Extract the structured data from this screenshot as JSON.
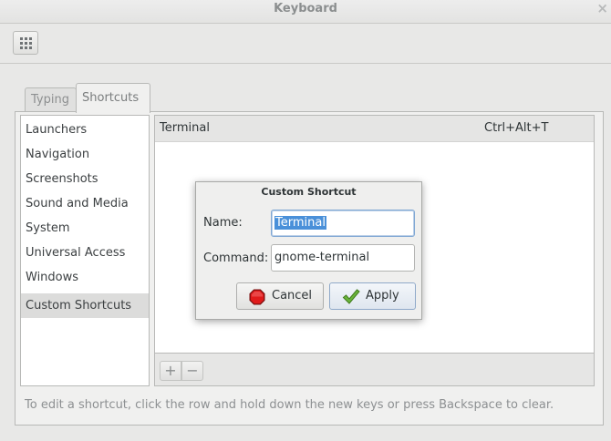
{
  "window": {
    "title": "Keyboard",
    "close_glyph": "×"
  },
  "toolbar": {
    "grid_icon": "grid-icon"
  },
  "tabs": [
    {
      "label": "Typing",
      "active": false
    },
    {
      "label": "Shortcuts",
      "active": true
    }
  ],
  "sidebar": {
    "items": [
      {
        "label": "Launchers"
      },
      {
        "label": "Navigation"
      },
      {
        "label": "Screenshots"
      },
      {
        "label": "Sound and Media"
      },
      {
        "label": "System"
      },
      {
        "label": "Universal Access"
      },
      {
        "label": "Windows"
      },
      {
        "label": "Custom Shortcuts",
        "selected": true
      }
    ]
  },
  "shortcuts": {
    "rows": [
      {
        "name": "Terminal",
        "accel": "Ctrl+Alt+T"
      }
    ],
    "add_glyph": "+",
    "remove_glyph": "−"
  },
  "hint": "To edit a shortcut, click the row and hold down the new keys or press Backspace to clear.",
  "dialog": {
    "title": "Custom Shortcut",
    "name_label": "Name:",
    "name_value": "Terminal",
    "command_label": "Command:",
    "command_value": "gnome-terminal",
    "cancel_label": "Cancel",
    "apply_label": "Apply"
  },
  "colors": {
    "selection": "#4a90d9",
    "cancel_icon": "#e01b1b",
    "apply_icon": "#5fa82d"
  }
}
